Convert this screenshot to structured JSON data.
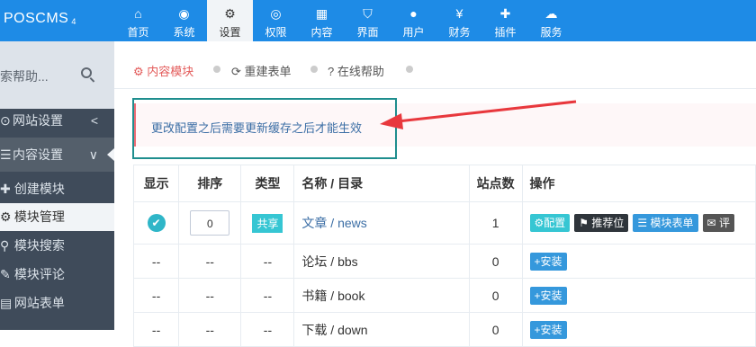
{
  "brand": {
    "name": "POSCMS",
    "version": "4"
  },
  "nav": [
    {
      "icon": "home-icon",
      "label": "首页"
    },
    {
      "icon": "globe-icon",
      "label": "系统"
    },
    {
      "icon": "gears-icon",
      "label": "设置",
      "active": true
    },
    {
      "icon": "user-circle-icon",
      "label": "权限"
    },
    {
      "icon": "grid-icon",
      "label": "内容"
    },
    {
      "icon": "html5-icon",
      "label": "界面"
    },
    {
      "icon": "user-icon",
      "label": "用户"
    },
    {
      "icon": "yen-icon",
      "label": "财务"
    },
    {
      "icon": "puzzle-icon",
      "label": "插件"
    },
    {
      "icon": "cloud-icon",
      "label": "服务"
    }
  ],
  "sidebar": {
    "search_placeholder": "索帮助...",
    "menus": [
      {
        "label": "网站设置",
        "chevron": "<"
      },
      {
        "label": "内容设置",
        "chevron": "∨",
        "active": true
      }
    ],
    "subitems": [
      {
        "label": "创建模块"
      },
      {
        "label": "模块管理",
        "active": true
      },
      {
        "label": "模块搜索"
      },
      {
        "label": "模块评论"
      },
      {
        "label": "网站表单"
      }
    ]
  },
  "breadcrumb": [
    {
      "icon": "gears-icon",
      "label": "内容模块",
      "active": true
    },
    {
      "icon": "refresh-icon",
      "label": "重建表单"
    },
    {
      "icon": "question-icon",
      "label": "在线帮助"
    }
  ],
  "note": "更改配置之后需要更新缓存之后才能生效",
  "table": {
    "headers": [
      "显示",
      "排序",
      "类型",
      "名称 / 目录",
      "站点数",
      "操作"
    ],
    "rows": [
      {
        "show": "✔",
        "order": "0",
        "type": "共享",
        "name": "文章 / news",
        "sites": "1",
        "actions": [
          "配置",
          "推荐位",
          "模块表单",
          "评"
        ]
      },
      {
        "show": "--",
        "order": "--",
        "type": "--",
        "name": "论坛 / bbs",
        "sites": "0",
        "actions": [
          "安装"
        ]
      },
      {
        "show": "--",
        "order": "--",
        "type": "--",
        "name": "书籍 / book",
        "sites": "0",
        "actions": [
          "安装"
        ]
      },
      {
        "show": "--",
        "order": "--",
        "type": "--",
        "name": "下载 / down",
        "sites": "0",
        "actions": [
          "安装"
        ]
      }
    ]
  },
  "colors": {
    "topbar": "#1e8be6",
    "sidebar": "#3f4b5a",
    "accent_red": "#e35b5a",
    "annotation": "#1f8e8e",
    "arrow": "#e8383d"
  }
}
